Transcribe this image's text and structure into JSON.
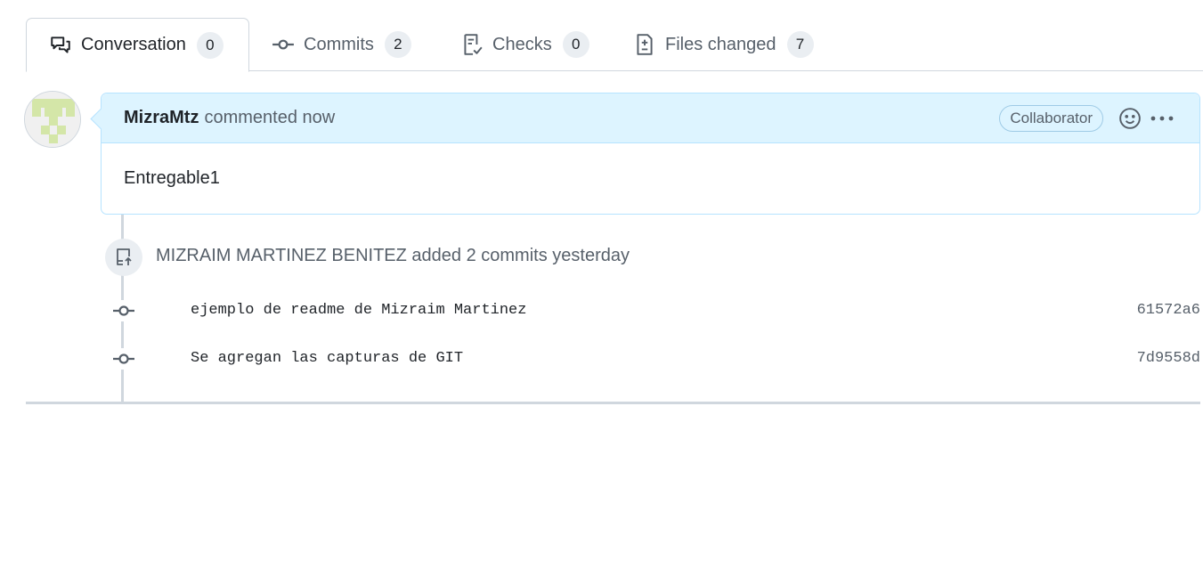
{
  "tabs": [
    {
      "label": "Conversation",
      "count": "0",
      "icon": "comment-discussion-icon"
    },
    {
      "label": "Commits",
      "count": "2",
      "icon": "git-commit-icon"
    },
    {
      "label": "Checks",
      "count": "0",
      "icon": "checklist-icon"
    },
    {
      "label": "Files changed",
      "count": "7",
      "icon": "file-diff-icon"
    }
  ],
  "comment": {
    "author": "MizraMtz",
    "action": "commented now",
    "badge": "Collaborator",
    "body": "Entregable1"
  },
  "commit_event": {
    "author": "MIZRAIM MARTINEZ BENITEZ",
    "text": "added 2 commits yesterday",
    "icon": "repo-push-icon"
  },
  "commits": [
    {
      "message": "ejemplo de readme de Mizraim Martinez",
      "sha": "61572a6"
    },
    {
      "message": "Se agregan las capturas de GIT",
      "sha": "7d9558d"
    }
  ],
  "colors": {
    "comment_header_bg": "#ddf4ff",
    "comment_border": "#b6e3ff",
    "avatar_pixel": "#d4e6a8"
  }
}
